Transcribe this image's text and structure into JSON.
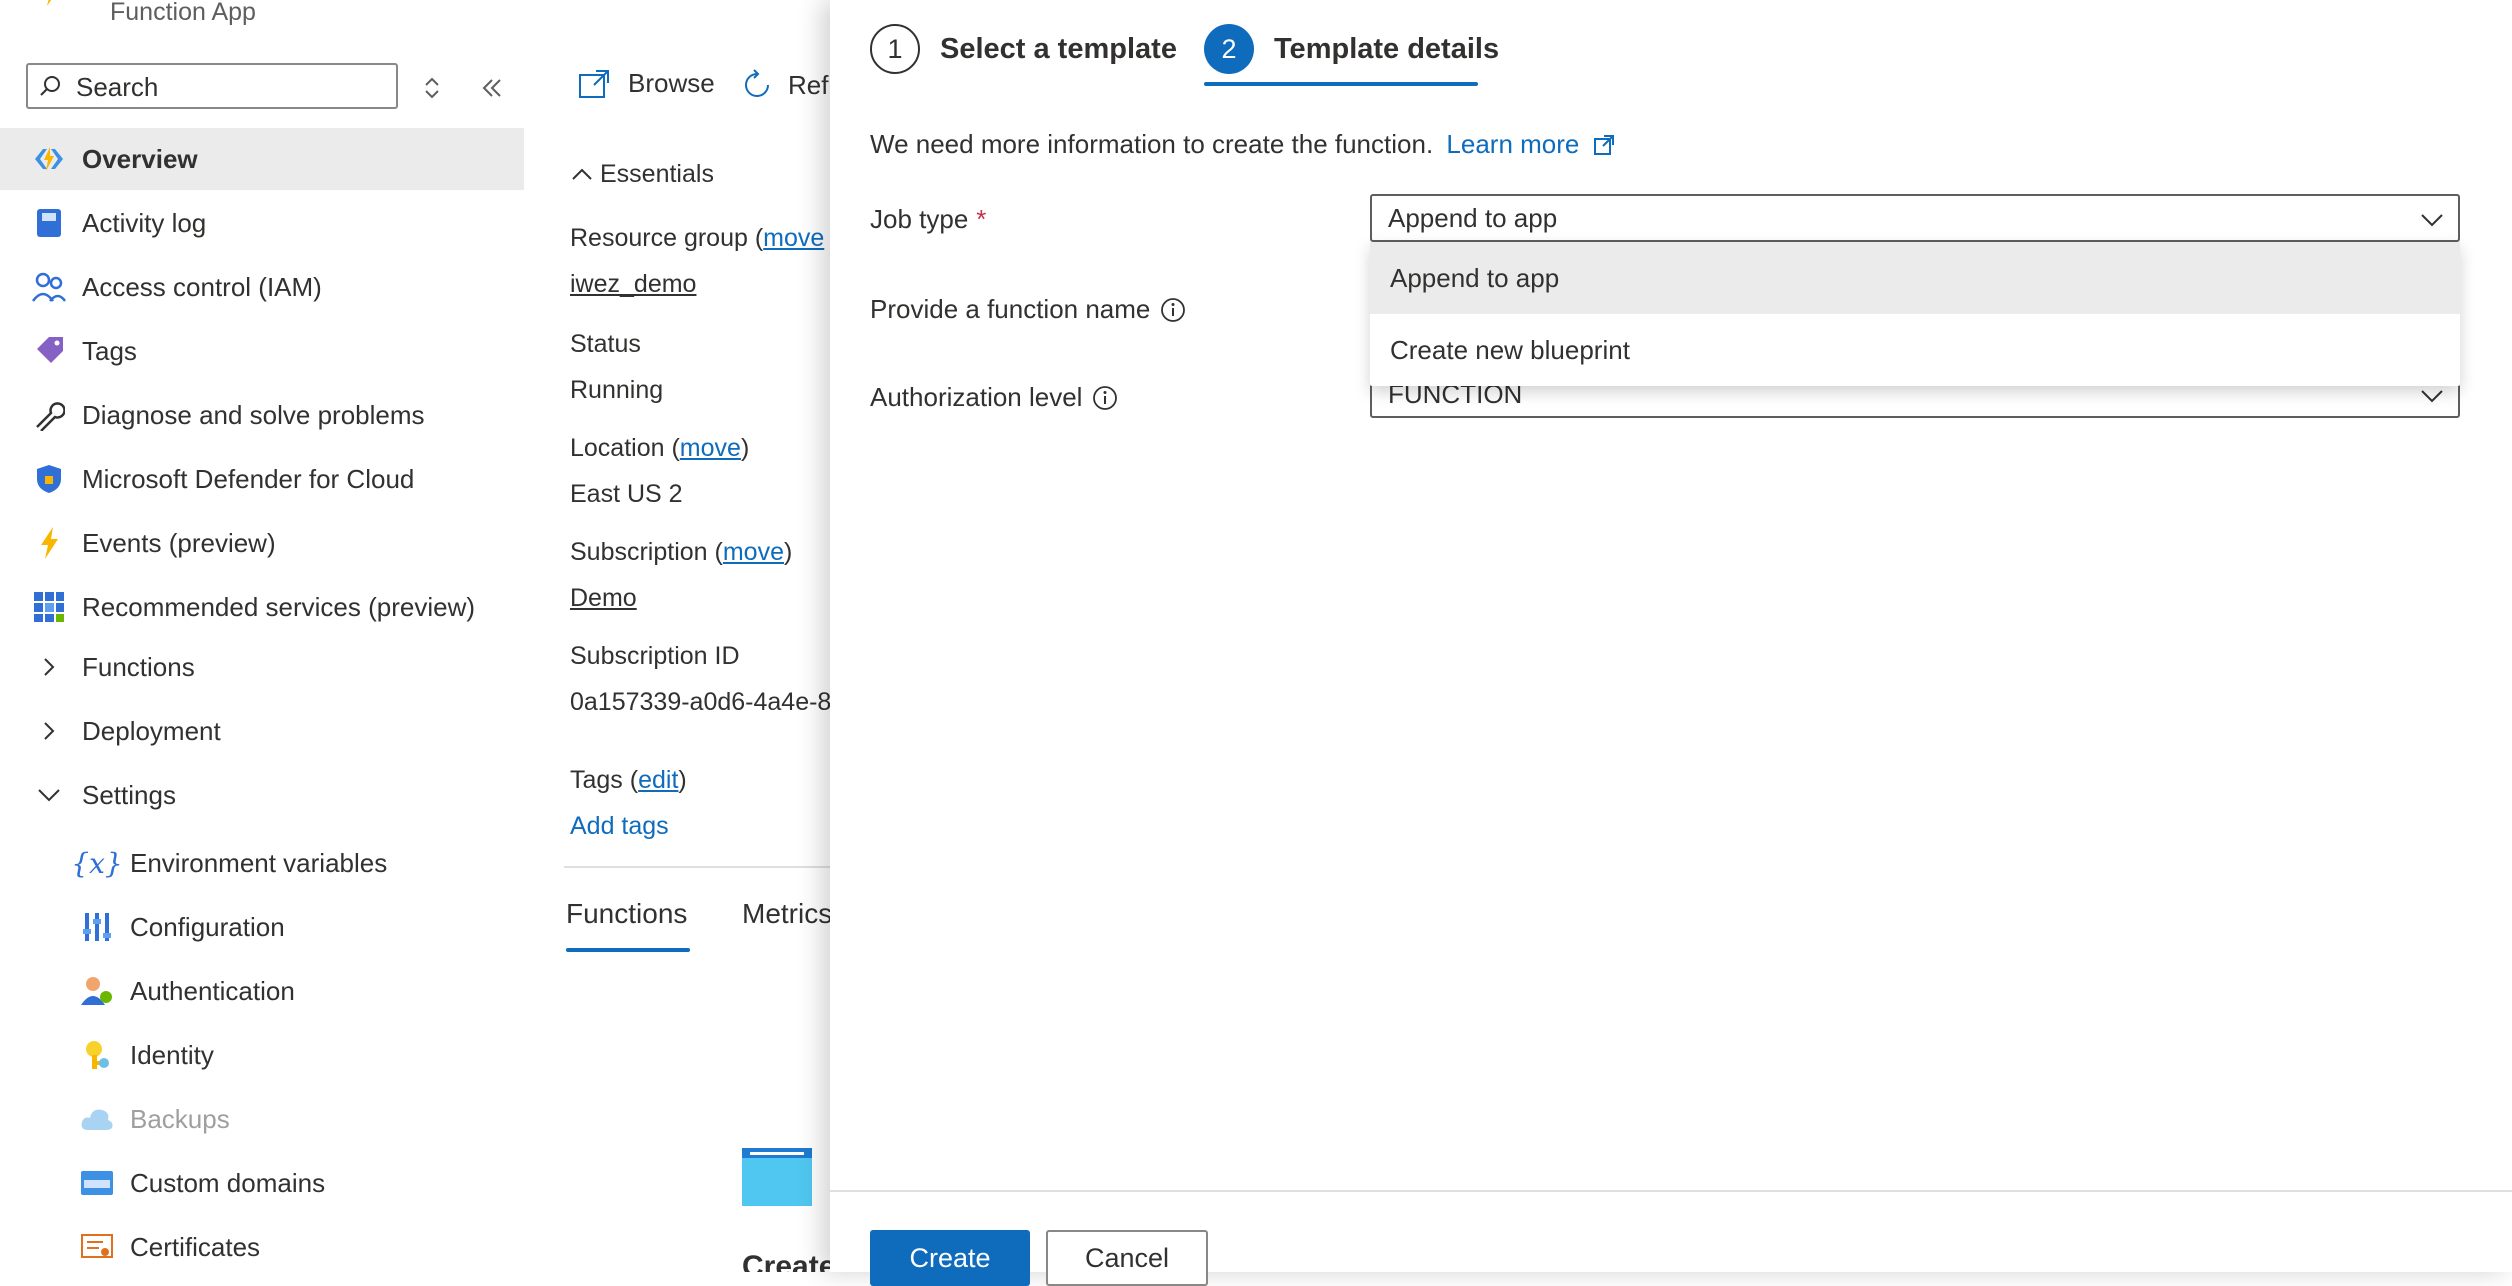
{
  "app": {
    "subtitle": "Function App"
  },
  "sidebar": {
    "search_placeholder": "Search",
    "items": [
      {
        "label": "Overview"
      },
      {
        "label": "Activity log"
      },
      {
        "label": "Access control (IAM)"
      },
      {
        "label": "Tags"
      },
      {
        "label": "Diagnose and solve problems"
      },
      {
        "label": "Microsoft Defender for Cloud"
      },
      {
        "label": "Events (preview)"
      },
      {
        "label": "Recommended services (preview)"
      },
      {
        "label": "Functions"
      },
      {
        "label": "Deployment"
      },
      {
        "label": "Settings"
      }
    ],
    "settings_items": [
      {
        "label": "Environment variables"
      },
      {
        "label": "Configuration"
      },
      {
        "label": "Authentication"
      },
      {
        "label": "Identity"
      },
      {
        "label": "Backups"
      },
      {
        "label": "Custom domains"
      },
      {
        "label": "Certificates"
      }
    ]
  },
  "overview": {
    "toolbar": {
      "browse": "Browse",
      "refresh": "Refr"
    },
    "essentials_label": "Essentials",
    "resource_group_label": "Resource group (",
    "resource_group_move": "move",
    "resource_group_value": "iwez_demo",
    "status_label": "Status",
    "status_value": "Running",
    "location_label": "Location (",
    "location_move": "move",
    "location_close": ")",
    "location_value": "East US 2",
    "subscription_label": "Subscription (",
    "subscription_move": "move",
    "subscription_close": ")",
    "subscription_value": "Demo",
    "subscription_id_label": "Subscription ID",
    "subscription_id_value": "0a157339-a0d6-4a4e-8",
    "tags_label": "Tags (",
    "tags_edit": "edit",
    "tags_close": ")",
    "add_tags": "Add tags",
    "tabs": [
      {
        "label": "Functions"
      },
      {
        "label": "Metrics"
      }
    ],
    "create_partial": "Create"
  },
  "panel": {
    "steps": [
      {
        "number": "1",
        "label": "Select a template"
      },
      {
        "number": "2",
        "label": "Template details"
      }
    ],
    "intro": "We need more information to create the function.",
    "learn_more": "Learn more",
    "job_type_label": "Job type",
    "job_type_required": "*",
    "job_type_value": "Append to app",
    "function_name_label": "Provide a function name",
    "auth_level_label": "Authorization level",
    "auth_level_value": "FUNCTION",
    "job_type_options": [
      {
        "label": "Append to app"
      },
      {
        "label": "Create new blueprint"
      }
    ],
    "create_button": "Create",
    "cancel_button": "Cancel"
  }
}
